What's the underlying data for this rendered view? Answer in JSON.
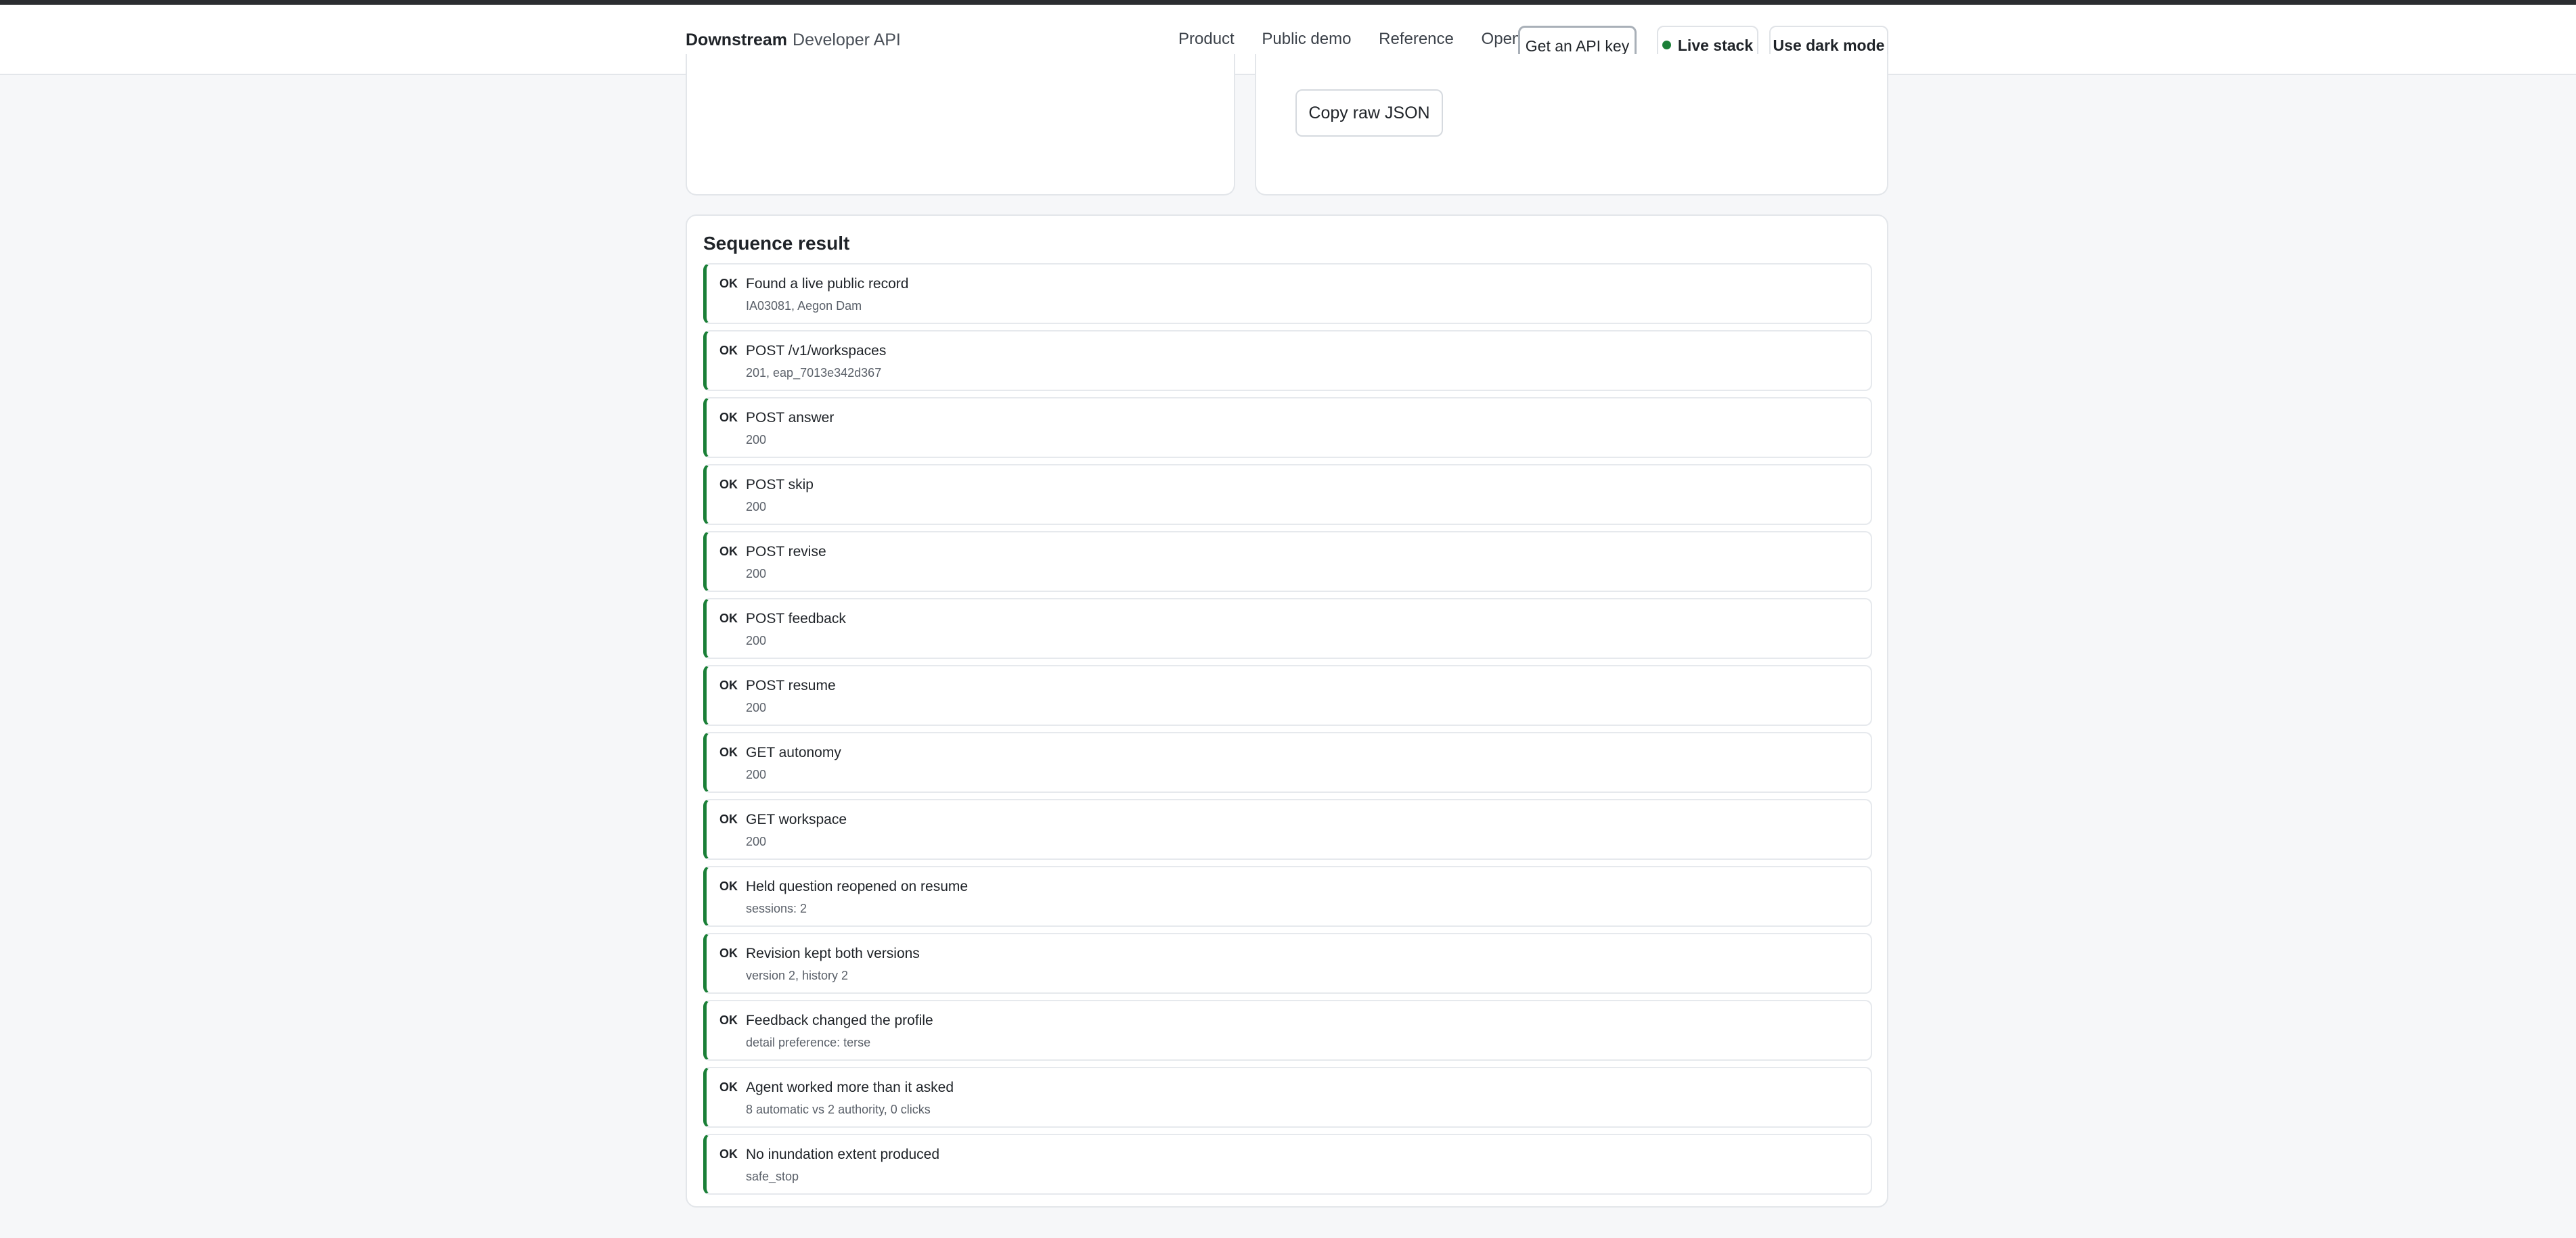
{
  "header": {
    "brand_name": "Downstream",
    "brand_sub": "Developer API",
    "nav": [
      "Product",
      "Public demo",
      "Reference",
      "OpenAPI"
    ],
    "api_key_button": "Get an API key",
    "live_stack_label": "Live stack",
    "dark_mode_button": "Use dark mode"
  },
  "raw_json_panel": {
    "copy_button": "Copy raw JSON"
  },
  "sequence": {
    "title": "Sequence result",
    "status_color": "#1a7f37",
    "rows": [
      {
        "status": "OK",
        "label": "Found a live public record",
        "detail": "IA03081, Aegon Dam"
      },
      {
        "status": "OK",
        "label": "POST /v1/workspaces",
        "detail": "201, eap_7013e342d367"
      },
      {
        "status": "OK",
        "label": "POST answer",
        "detail": "200"
      },
      {
        "status": "OK",
        "label": "POST skip",
        "detail": "200"
      },
      {
        "status": "OK",
        "label": "POST revise",
        "detail": "200"
      },
      {
        "status": "OK",
        "label": "POST feedback",
        "detail": "200"
      },
      {
        "status": "OK",
        "label": "POST resume",
        "detail": "200"
      },
      {
        "status": "OK",
        "label": "GET autonomy",
        "detail": "200"
      },
      {
        "status": "OK",
        "label": "GET workspace",
        "detail": "200"
      },
      {
        "status": "OK",
        "label": "Held question reopened on resume",
        "detail": "sessions: 2"
      },
      {
        "status": "OK",
        "label": "Revision kept both versions",
        "detail": "version 2, history 2"
      },
      {
        "status": "OK",
        "label": "Feedback changed the profile",
        "detail": "detail preference: terse"
      },
      {
        "status": "OK",
        "label": "Agent worked more than it asked",
        "detail": "8 automatic vs 2 authority, 0 clicks"
      },
      {
        "status": "OK",
        "label": "No inundation extent produced",
        "detail": "safe_stop"
      }
    ]
  }
}
